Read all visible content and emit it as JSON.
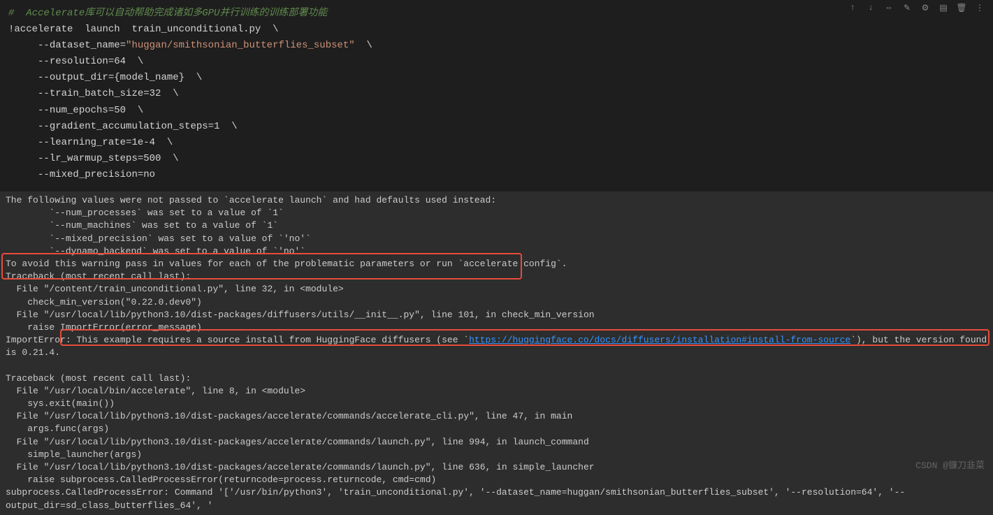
{
  "code": {
    "comment": "#  Accelerate库可以自动帮助完成诸如多GPU并行训练的训练部署功能",
    "line1_bang": "!",
    "line1_cmd1": "accelerate",
    "line1_cmd2": "launch",
    "line1_file": "train_unconditional.py",
    "line1_bs": "\\",
    "arg1_flag": "--dataset_name",
    "arg1_eq": "=",
    "arg1_val": "\"huggan/smithsonian_butterflies_subset\"",
    "arg2_flag": "--resolution",
    "arg2_val": "64",
    "arg3_flag": "--output_dir",
    "arg3_val": "{model_name}",
    "arg4_flag": "--train_batch_size",
    "arg4_val": "32",
    "arg5_flag": "--num_epochs",
    "arg5_val": "50",
    "arg6_flag": "--gradient_accumulation_steps",
    "arg6_val": "1",
    "arg7_flag": "--learning_rate",
    "arg7_val": "1e-4",
    "arg8_flag": "--lr_warmup_steps",
    "arg8_val": "500",
    "arg9_flag": "--mixed_precision",
    "arg9_val": "no"
  },
  "output": {
    "line1": "The following values were not passed to `accelerate launch` and had defaults used instead:",
    "line2": "        `--num_processes` was set to a value of `1`",
    "line3": "        `--num_machines` was set to a value of `1`",
    "line4": "        `--mixed_precision` was set to a value of `'no'`",
    "line5": "        `--dynamo_backend` was set to a value of `'no'`",
    "line6": "To avoid this warning pass in values for each of the problematic parameters or run `accelerate config`.",
    "line7": "Traceback (most recent call last):",
    "line8": "  File \"/content/train_unconditional.py\", line 32, in <module>",
    "line9": "    check_min_version(\"0.22.0.dev0\")",
    "line10": "  File \"/usr/local/lib/python3.10/dist-packages/diffusers/utils/__init__.py\", line 101, in check_min_version",
    "line11": "    raise ImportError(error_message)",
    "line12_prefix": "ImportError: This example requires a source install from HuggingFace diffusers (see `",
    "line12_link": "https://huggingface.co/docs/diffusers/installation#install-from-source",
    "line12_suffix": "`), but the version found is 0.21.4.",
    "line13": "",
    "line14": "Traceback (most recent call last):",
    "line15": "  File \"/usr/local/bin/accelerate\", line 8, in <module>",
    "line16": "    sys.exit(main())",
    "line17": "  File \"/usr/local/lib/python3.10/dist-packages/accelerate/commands/accelerate_cli.py\", line 47, in main",
    "line18": "    args.func(args)",
    "line19": "  File \"/usr/local/lib/python3.10/dist-packages/accelerate/commands/launch.py\", line 994, in launch_command",
    "line20": "    simple_launcher(args)",
    "line21": "  File \"/usr/local/lib/python3.10/dist-packages/accelerate/commands/launch.py\", line 636, in simple_launcher",
    "line22": "    raise subprocess.CalledProcessError(returncode=process.returncode, cmd=cmd)",
    "line23": "subprocess.CalledProcessError: Command '['/usr/bin/python3', 'train_unconditional.py', '--dataset_name=huggan/smithsonian_butterflies_subset', '--resolution=64', '--output_dir=sd_class_butterflies_64', '"
  },
  "watermark": "CSDN @镰刀韭菜"
}
